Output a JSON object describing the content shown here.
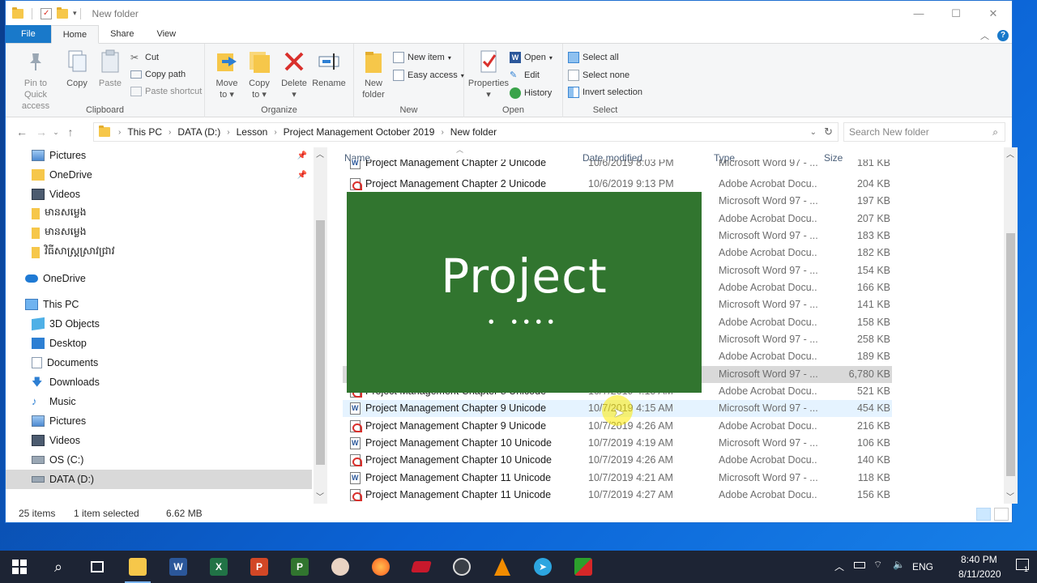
{
  "titlebar": {
    "title": "New folder"
  },
  "tabs": [
    {
      "label": "File"
    },
    {
      "label": "Home"
    },
    {
      "label": "Share"
    },
    {
      "label": "View"
    }
  ],
  "ribbon": {
    "clipboard": {
      "label": "Clipboard",
      "pin_line1": "Pin to Quick",
      "pin_line2": "access",
      "copy": "Copy",
      "paste": "Paste",
      "cut": "Cut",
      "copy_path": "Copy path",
      "paste_shortcut": "Paste shortcut"
    },
    "organize": {
      "label": "Organize",
      "move_to_line1": "Move",
      "move_to_line2": "to",
      "copy_to_line1": "Copy",
      "copy_to_line2": "to",
      "delete": "Delete",
      "rename": "Rename"
    },
    "new": {
      "label": "New",
      "new_folder_line1": "New",
      "new_folder_line2": "folder",
      "new_item": "New item",
      "easy_access": "Easy access"
    },
    "open": {
      "label": "Open",
      "properties": "Properties",
      "open": "Open",
      "edit": "Edit",
      "history": "History"
    },
    "select": {
      "label": "Select",
      "select_all": "Select all",
      "select_none": "Select none",
      "invert": "Invert selection"
    }
  },
  "address": {
    "crumbs": [
      "This PC",
      "DATA (D:)",
      "Lesson",
      "Project Management October 2019",
      "New folder"
    ],
    "search_placeholder": "Search New folder"
  },
  "navpane": {
    "items": [
      {
        "label": "Pictures"
      },
      {
        "label": "OneDrive"
      },
      {
        "label": "Videos"
      },
      {
        "label": "មានសម្លេង"
      },
      {
        "label": "មានសម្លេង"
      },
      {
        "label": "វិធីសាស្ត្រស្រាវជ្រាវ"
      },
      {
        "label": "OneDrive"
      },
      {
        "label": "This PC"
      },
      {
        "label": "3D Objects"
      },
      {
        "label": "Desktop"
      },
      {
        "label": "Documents"
      },
      {
        "label": "Downloads"
      },
      {
        "label": "Music"
      },
      {
        "label": "Pictures"
      },
      {
        "label": "Videos"
      },
      {
        "label": "OS (C:)"
      },
      {
        "label": "DATA (D:)"
      }
    ]
  },
  "columns": {
    "name": "Name",
    "date": "Date modified",
    "type": "Type",
    "size": "Size"
  },
  "files": [
    {
      "name": "Project Management Chapter 2 Unicode",
      "date": "10/6/2019 8:03 PM",
      "type": "Microsoft Word 97 - ...",
      "size": "181 KB",
      "kind": "word"
    },
    {
      "name": "Project Management Chapter 2 Unicode",
      "date": "10/6/2019 9:13 PM",
      "type": "Adobe Acrobat Docu...",
      "size": "204 KB",
      "kind": "pdf"
    },
    {
      "name": "",
      "date": "",
      "type": "Microsoft Word 97 - ...",
      "size": "197 KB",
      "kind": ""
    },
    {
      "name": "",
      "date": "",
      "type": "Adobe Acrobat Docu...",
      "size": "207 KB",
      "kind": ""
    },
    {
      "name": "",
      "date": "",
      "type": "Microsoft Word 97 - ...",
      "size": "183 KB",
      "kind": ""
    },
    {
      "name": "",
      "date": "",
      "type": "Adobe Acrobat Docu...",
      "size": "182 KB",
      "kind": ""
    },
    {
      "name": "",
      "date": "",
      "type": "Microsoft Word 97 - ...",
      "size": "154 KB",
      "kind": ""
    },
    {
      "name": "",
      "date": "",
      "type": "Adobe Acrobat Docu...",
      "size": "166 KB",
      "kind": ""
    },
    {
      "name": "",
      "date": "",
      "type": "Microsoft Word 97 - ...",
      "size": "141 KB",
      "kind": ""
    },
    {
      "name": "",
      "date": "",
      "type": "Adobe Acrobat Docu...",
      "size": "158 KB",
      "kind": ""
    },
    {
      "name": "",
      "date": "",
      "type": "Microsoft Word 97 - ...",
      "size": "258 KB",
      "kind": ""
    },
    {
      "name": "",
      "date": "",
      "type": "Adobe Acrobat Docu...",
      "size": "189 KB",
      "kind": ""
    },
    {
      "name": "",
      "date": "",
      "type": "Microsoft Word 97 - ...",
      "size": "6,780 KB",
      "kind": ""
    },
    {
      "name": "Project Management Chapter 8 Unicode",
      "date": "10/7/2019 4:15 AM",
      "type": "Adobe Acrobat Docu...",
      "size": "521 KB",
      "kind": "pdf"
    },
    {
      "name": "Project Management Chapter 9 Unicode",
      "date": "10/7/2019 4:15 AM",
      "type": "Microsoft Word 97 - ...",
      "size": "454 KB",
      "kind": "word"
    },
    {
      "name": "Project Management Chapter 9 Unicode",
      "date": "10/7/2019 4:26 AM",
      "type": "Adobe Acrobat Docu...",
      "size": "216 KB",
      "kind": "pdf"
    },
    {
      "name": "Project Management Chapter 10 Unicode",
      "date": "10/7/2019 4:19 AM",
      "type": "Microsoft Word 97 - ...",
      "size": "106 KB",
      "kind": "word"
    },
    {
      "name": "Project Management Chapter 10 Unicode",
      "date": "10/7/2019 4:26 AM",
      "type": "Adobe Acrobat Docu...",
      "size": "140 KB",
      "kind": "pdf"
    },
    {
      "name": "Project Management Chapter 11 Unicode",
      "date": "10/7/2019 4:21 AM",
      "type": "Microsoft Word 97 - ...",
      "size": "118 KB",
      "kind": "word"
    },
    {
      "name": "Project Management Chapter 11 Unicode",
      "date": "10/7/2019 4:27 AM",
      "type": "Adobe Acrobat Docu...",
      "size": "156 KB",
      "kind": "pdf"
    }
  ],
  "splash": {
    "title": "Project",
    "dots": "• ••••",
    "color": "#31752f"
  },
  "status": {
    "count": "25 items",
    "selected": "1 item selected",
    "size": "6.62 MB"
  },
  "taskbar": {
    "apps": [
      {
        "name": "windows-start",
        "glyph": ""
      },
      {
        "name": "search",
        "glyph": ""
      },
      {
        "name": "task-view",
        "glyph": ""
      },
      {
        "name": "file-explorer",
        "glyph": ""
      },
      {
        "name": "word",
        "glyph": "W"
      },
      {
        "name": "excel",
        "glyph": "X"
      },
      {
        "name": "powerpoint",
        "glyph": "P"
      },
      {
        "name": "project",
        "glyph": "P"
      },
      {
        "name": "app-seal",
        "glyph": ""
      },
      {
        "name": "firefox",
        "glyph": ""
      },
      {
        "name": "book-app",
        "glyph": ""
      },
      {
        "name": "obs",
        "glyph": ""
      },
      {
        "name": "vlc",
        "glyph": ""
      },
      {
        "name": "telegram",
        "glyph": ""
      },
      {
        "name": "other-app",
        "glyph": ""
      }
    ],
    "lang": "ENG",
    "time": "8:40 PM",
    "date": "8/11/2020",
    "notif_count": "1"
  },
  "colors": {
    "accent": "#1979ca",
    "project_green": "#31752f",
    "selection": "#d9d9d9",
    "hover": "#e5f3ff"
  }
}
